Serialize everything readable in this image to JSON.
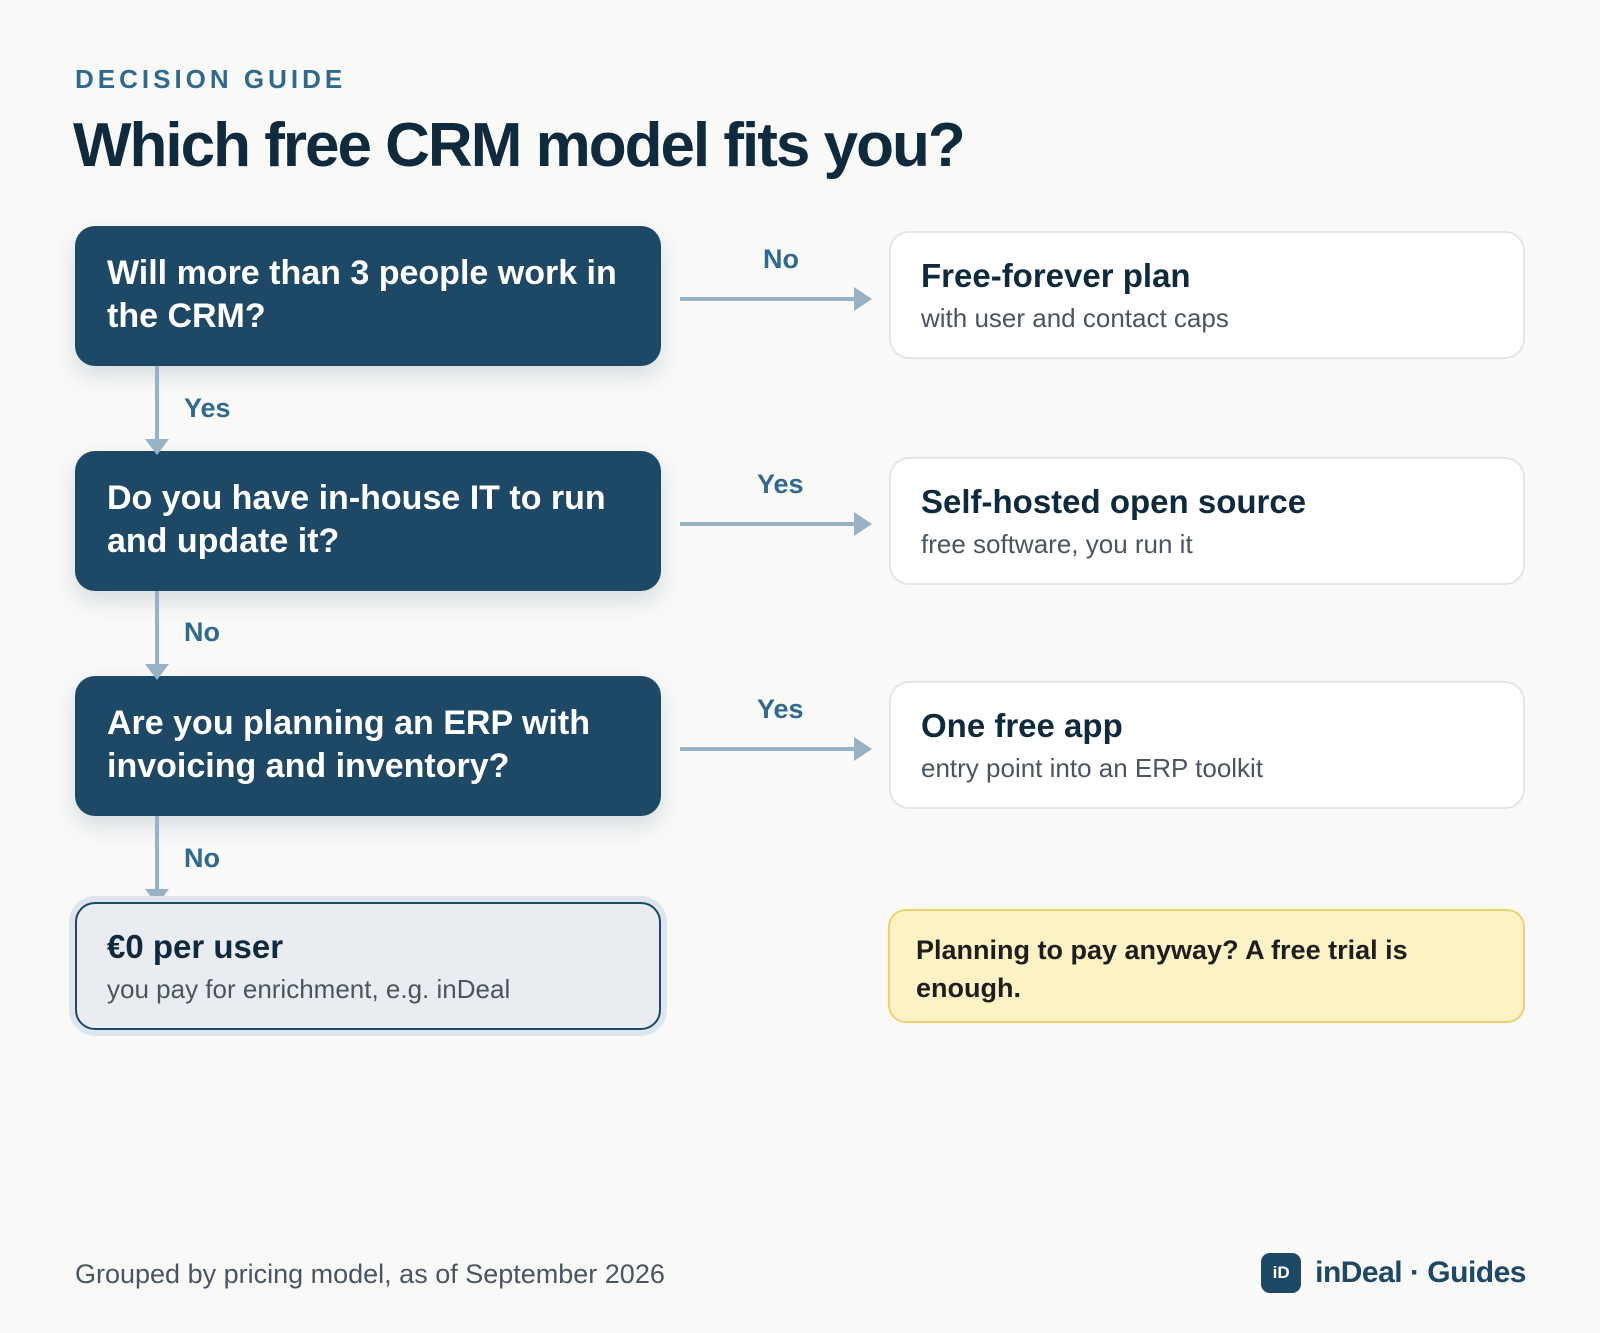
{
  "header": {
    "eyebrow": "DECISION GUIDE",
    "title": "Which free CRM model fits you?"
  },
  "questions": [
    {
      "text": "Will more than 3 people work in the CRM?",
      "side_label": "No",
      "down_label": "Yes"
    },
    {
      "text": "Do you have in-house IT to run and update it?",
      "side_label": "Yes",
      "down_label": "No"
    },
    {
      "text": "Are you planning an ERP with invoicing and inventory?",
      "side_label": "Yes",
      "down_label": "No"
    }
  ],
  "outcomes": [
    {
      "title": "Free-forever plan",
      "subtitle": "with user and contact caps"
    },
    {
      "title": "Self-hosted open source",
      "subtitle": "free software, you run it"
    },
    {
      "title": "One free app",
      "subtitle": "entry point into an ERP toolkit"
    }
  ],
  "final_result": {
    "title": "€0 per user",
    "subtitle": "you pay for enrichment, e.g. inDeal"
  },
  "note": "Planning to pay anyway? A free trial is enough.",
  "footer": {
    "caption": "Grouped by pricing model, as of September 2026",
    "logo_text": "iD",
    "brand": "inDeal · Guides"
  },
  "colors": {
    "background": "#f9f9f8",
    "question_fill": "#1d4866",
    "accent_text": "#2f6a8e",
    "connector": "#97b1c7",
    "note_fill": "#fdf2c4"
  }
}
